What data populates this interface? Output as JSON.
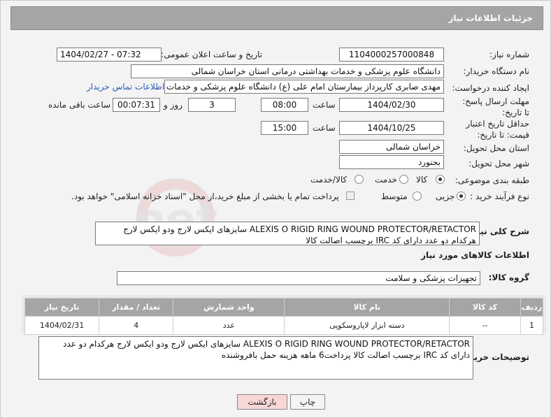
{
  "header_title": "جزئیات اطلاعات نیاز",
  "need_number": {
    "label": "شماره نیاز:",
    "value": "1104000257000848"
  },
  "announce": {
    "label": "تاریخ و ساعت اعلان عمومی:",
    "value": "1404/02/27 - 07:32"
  },
  "buyer": {
    "label": "نام دستگاه خریدار:",
    "value": "دانشگاه علوم پزشکی و خدمات بهداشتی درمانی استان خراسان شمالی"
  },
  "creator": {
    "label": "ایجاد کننده درخواست:",
    "value": "مهدی صابری کارپرداز بیمارستان امام علی (ع) دانشگاه علوم پزشکی و خدمات بهداشتی",
    "contact_link": "اطلاعات تماس خریدار"
  },
  "deadline": {
    "label": "مهلت ارسال پاسخ: تا تاریخ:",
    "date": "1404/02/30",
    "time_label": "ساعت",
    "time": "08:00",
    "days": "3",
    "days_label": "روز و",
    "remaining": "00:07:31",
    "remaining_label": "ساعت باقی مانده"
  },
  "validity": {
    "label": "حداقل تاریخ اعتبار قیمت: تا تاریخ:",
    "date": "1404/10/25",
    "time_label": "ساعت",
    "time": "15:00"
  },
  "province": {
    "label": "استان محل تحویل:",
    "value": "خراسان شمالی"
  },
  "city": {
    "label": "شهر محل تحویل:",
    "value": "بجنورد"
  },
  "category": {
    "label": "طبقه بندی موضوعی:",
    "options": [
      "کالا",
      "خدمت",
      "کالا/خدمت"
    ],
    "selected": "کالا"
  },
  "process": {
    "label": "نوع فرآیند خرید :",
    "options": [
      "جزیی",
      "متوسط"
    ],
    "selected": "جزیی",
    "payment_note": "پرداخت تمام یا بخشی از مبلغ خرید،از محل \"اسناد خزانه اسلامی\" خواهد بود."
  },
  "description": {
    "label": "شرح کلی نیاز:",
    "text": "ALEXIS O RIGID RING WOUND PROTECTOR/RETACTOR سایزهای ایکس لارج ودو ایکس لارج هرکدام دو عدد  دارای کد IRC برچسب اصالت کالا"
  },
  "goods_section_title": "اطلاعات کالاهای مورد نیاز",
  "goods_group": {
    "label": "گروه کالا:",
    "value": "تجهیزات پزشکی و سلامت"
  },
  "table": {
    "headers": [
      "ردیف",
      "کد کالا",
      "نام کالا",
      "واحد شمارش",
      "تعداد / مقدار",
      "تاریخ نیاز"
    ],
    "rows": [
      [
        "1",
        "--",
        "دسته ابزار لاپاروسکوپی",
        "عدد",
        "4",
        "1404/02/31"
      ]
    ]
  },
  "buyer_notes": {
    "label": "توضیحات خریدار:",
    "text": "ALEXIS O RIGID RING WOUND PROTECTOR/RETACTOR سایزهای ایکس لارج ودو ایکس لارج هرکدام دو عدد  دارای کد IRC برچسب اصالت کالا پرداخت6 ماهه هزینه حمل بافروشنده"
  },
  "buttons": {
    "print": "چاپ",
    "back": "بازگشت"
  },
  "watermark": "AriaTender.net",
  "colors": {
    "header": "#a5a5a5",
    "link": "#2a59b7",
    "back_button": "#f8d7d7"
  }
}
